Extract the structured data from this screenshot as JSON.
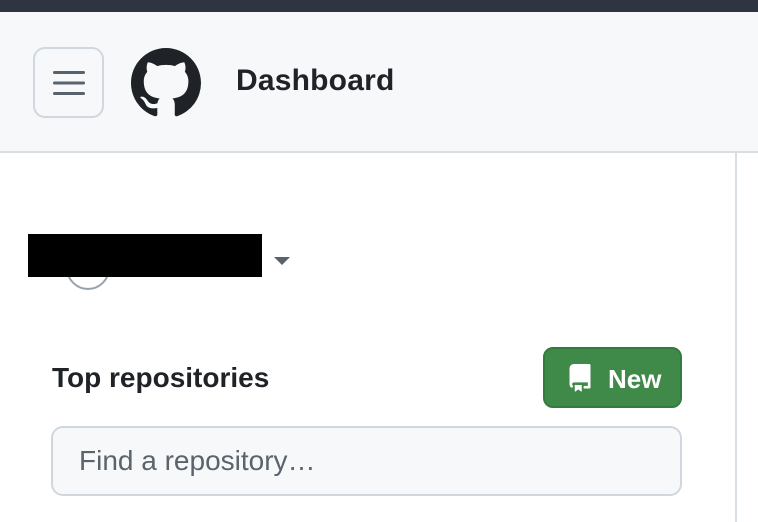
{
  "header": {
    "title": "Dashboard",
    "menu_icon": "hamburger-icon",
    "logo_icon": "github-octocat-icon"
  },
  "account": {
    "avatar_icon": "avatar",
    "name_redacted": true,
    "caret_icon": "triangle-down-icon"
  },
  "repositories": {
    "heading": "Top repositories",
    "new_button_label": "New",
    "new_button_icon": "repo-icon",
    "search_placeholder": "Find a repository…"
  },
  "colors": {
    "top_strip": "#2f3441",
    "header_bg": "#f6f8fa",
    "primary_button": "#3f8a49",
    "text": "#1f2328"
  }
}
